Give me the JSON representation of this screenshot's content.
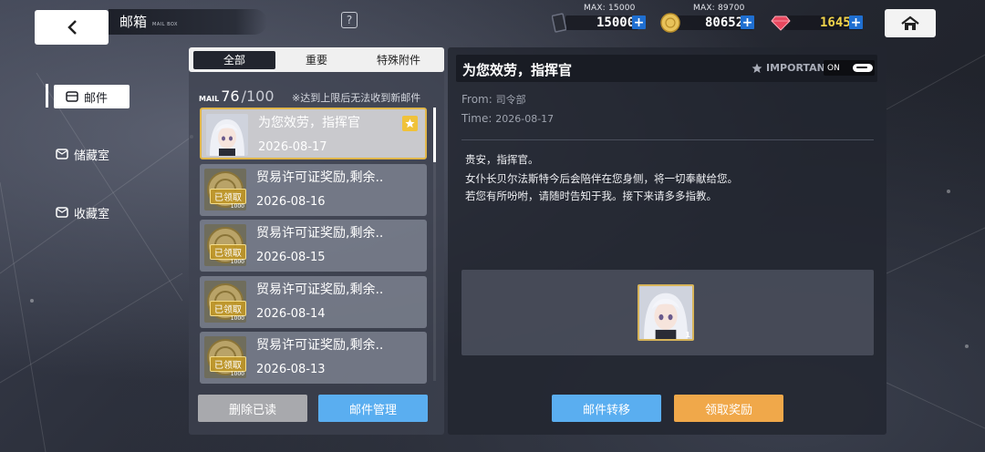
{
  "header": {
    "title": "邮箱",
    "subtitle": "MAIL BOX",
    "help_label": "?"
  },
  "resources": [
    {
      "name": "stamina",
      "icon": "card-icon",
      "max": "MAX: 15000",
      "value": "15000",
      "color": "#ffffff"
    },
    {
      "name": "coin",
      "icon": "coin-icon",
      "max": "MAX: 89700",
      "value": "80652",
      "color": "#ffffff"
    },
    {
      "name": "gem",
      "icon": "gem-icon",
      "max": "",
      "value": "1645",
      "color": "#f2d44a"
    }
  ],
  "plus_label": "+",
  "sidebar": {
    "items": [
      {
        "label": "邮件",
        "icon": "mail-icon",
        "active": true
      },
      {
        "label": "储藏室",
        "icon": "mail-icon",
        "active": false
      },
      {
        "label": "收藏室",
        "icon": "mail-icon",
        "active": false
      }
    ]
  },
  "list": {
    "tabs": [
      {
        "label": "全部",
        "active": true
      },
      {
        "label": "重要",
        "active": false
      },
      {
        "label": "特殊附件",
        "active": false
      }
    ],
    "mail_label": "MAIL",
    "count": "76",
    "max": "/100",
    "note": "※达到上限后无法收到新邮件",
    "claimed_label": "已领取",
    "items": [
      {
        "subject": "为您效劳，指挥官",
        "date": "2026-08-17",
        "type": "character",
        "selected": true,
        "starred": true
      },
      {
        "subject": "贸易许可证奖励,剩余..",
        "date": "2026-08-16",
        "type": "coin",
        "amount": "1000",
        "claimed": true
      },
      {
        "subject": "贸易许可证奖励,剩余..",
        "date": "2026-08-15",
        "type": "coin",
        "amount": "1000",
        "claimed": true
      },
      {
        "subject": "贸易许可证奖励,剩余..",
        "date": "2026-08-14",
        "type": "coin",
        "amount": "1000",
        "claimed": true
      },
      {
        "subject": "贸易许可证奖励,剩余..",
        "date": "2026-08-13",
        "type": "coin",
        "amount": "1000",
        "claimed": true
      }
    ],
    "delete_read_label": "删除已读",
    "manage_label": "邮件管理"
  },
  "detail": {
    "title": "为您效劳，指挥官",
    "important_label": "IMPORTANT",
    "toggle_label": "ON",
    "from_label": "From:",
    "from_value": "司令部",
    "time_label": "Time:",
    "time_value": "2026-08-17",
    "body": [
      "贵安，指挥官。",
      "女仆长贝尔法斯特今后会陪伴在您身侧，将一切奉献给您。",
      "若您有所吩咐，请随时告知于我。接下来请多多指教。"
    ],
    "attachment": {
      "type": "character",
      "count": "1"
    },
    "transfer_label": "邮件转移",
    "claim_label": "领取奖励"
  },
  "colors": {
    "accent_blue": "#5aaef0",
    "accent_orange": "#f0a84a",
    "selected_border": "#e0b64a",
    "plus_blue": "#1f6fd1"
  }
}
